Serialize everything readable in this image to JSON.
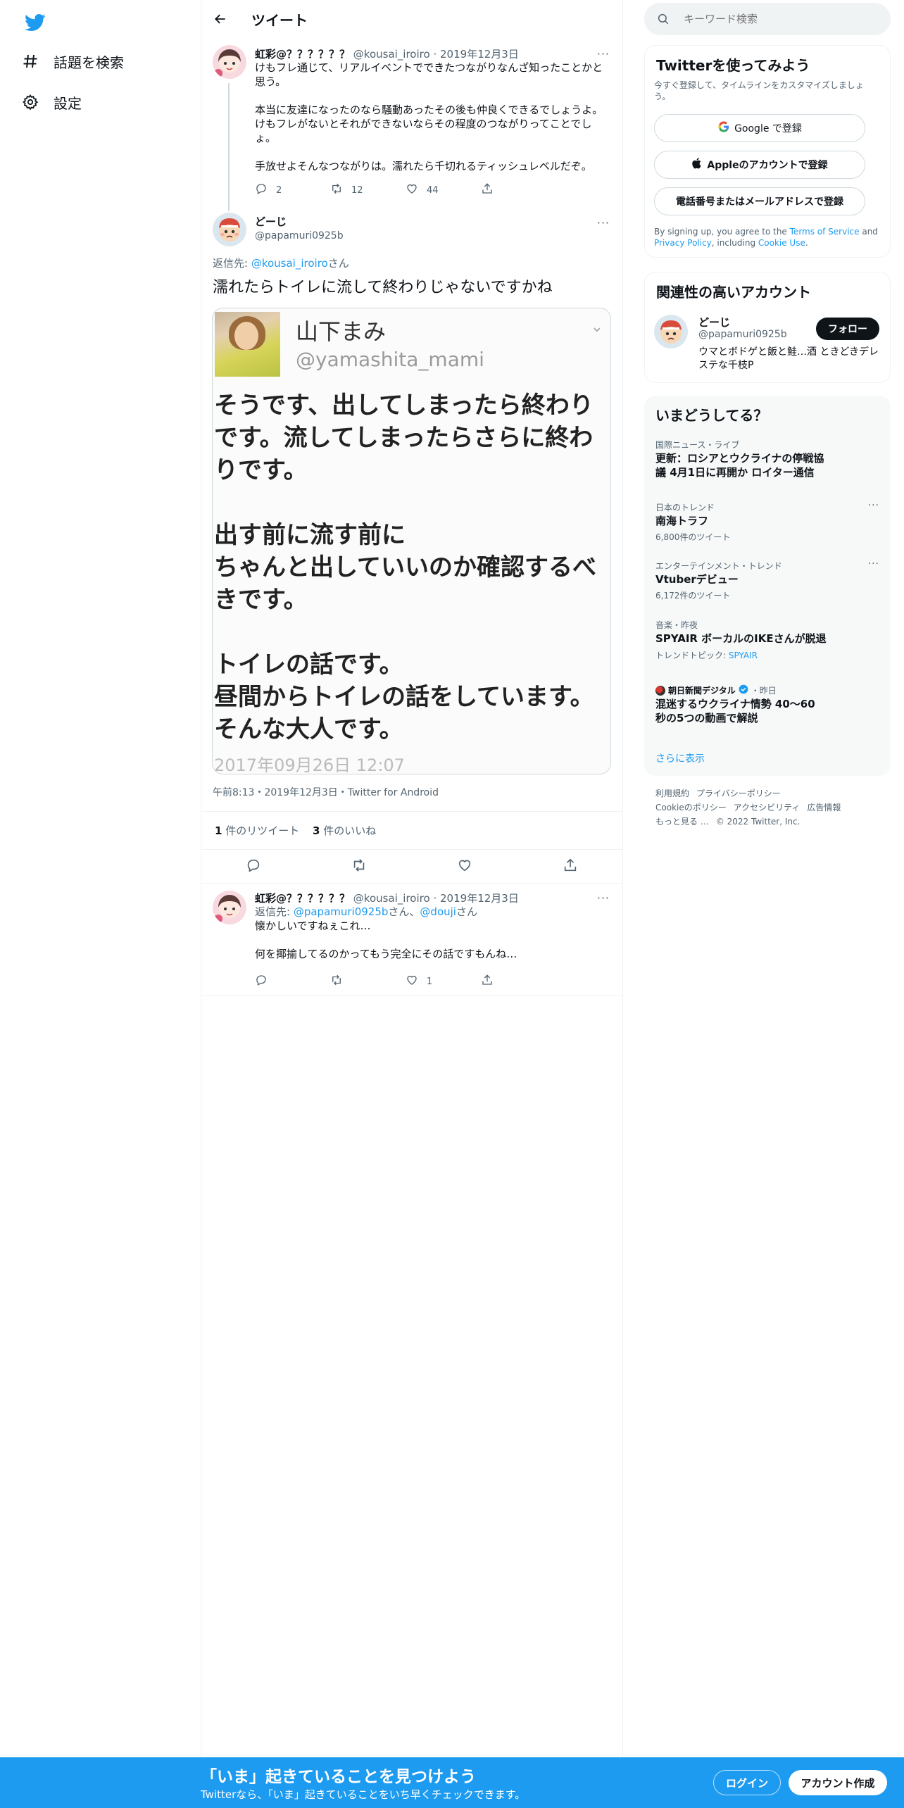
{
  "nav": {
    "logo": "twitter-bird-icon",
    "items": [
      {
        "label": "話題を検索",
        "icon": "hashtag-icon"
      },
      {
        "label": "設定",
        "icon": "gear-icon"
      }
    ]
  },
  "header": {
    "title": "ツイート"
  },
  "parent_tweet": {
    "name": "虹彩@？？？？？？",
    "handle": "@kousai_iroiro",
    "date": "2019年12月3日",
    "lines": [
      "けもフレ通じて、リアルイベントでできたつながりなんざ知ったことかと思う。",
      "",
      "本当に友達になったのなら騒動あったその後も仲良くできるでしょうよ。けもフレがないとそれができないならその程度のつながりってことでしょ。",
      "",
      "手放せよそんなつながりは。濡れたら千切れるティッシュレベルだぞ。"
    ],
    "replies": "2",
    "retweets": "12",
    "likes": "44"
  },
  "main_tweet": {
    "name": "どーじ",
    "handle": "@papamuri0925b",
    "reply_to_prefix": "返信先: ",
    "reply_to_handle": "@kousai_iroiro",
    "reply_to_suffix": "さん",
    "text": "濡れたらトイレに流して終わりじゃないですかね",
    "embedded_image": {
      "name": "山下まみ",
      "handle": "@yamashita_mami",
      "body": "そうです、出してしまったら終わりです。流してしまったらさらに終わりです。\n\n出す前に流す前に\nちゃんと出していいのか確認するべきです。\n\nトイレの話です。\n昼間からトイレの話をしています。\nそんな大人です。",
      "date": "2017年09月26日 12:07"
    },
    "meta": "午前8:13・2019年12月3日・Twitter for Android",
    "retweet_count": "1",
    "retweet_label": " 件のリツイート",
    "like_count": "3",
    "like_label": " 件のいいね"
  },
  "reply_tweet": {
    "name": "虹彩@？？？？？？",
    "handle": "@kousai_iroiro",
    "date": "2019年12月3日",
    "reply_to_prefix": "返信先: ",
    "reply_to_handle1": "@papamuri0925b",
    "reply_to_mid": "さん、",
    "reply_to_handle2": "@douji",
    "reply_to_suffix": "さん",
    "line1": "懐かしいですねぇこれ…",
    "line2": "何を揶揄してるのかってもう完全にその話ですもんね…",
    "likes": "1"
  },
  "search": {
    "placeholder": "キーワード検索"
  },
  "signup_card": {
    "title": "Twitterを使ってみよう",
    "subtitle": "今すぐ登録して、タイムラインをカスタマイズしましょう。",
    "google": "Google で登録",
    "apple": "Appleのアカウントで登録",
    "phone": "電話番号またはメールアドレスで登録",
    "legal_1": "By signing up, you agree to the ",
    "tos": "Terms of Service",
    "legal_2": " and ",
    "privacy": "Privacy Policy",
    "legal_3": ", including ",
    "cookie": "Cookie Use",
    "legal_4": "."
  },
  "related": {
    "title": "関連性の高いアカウント",
    "name": "どーじ",
    "handle": "@papamuri0925b",
    "bio": "ウマとボドゲと飯と鮭…酒 ときどきデレステな千枝P",
    "follow": "フォロー"
  },
  "trends": {
    "title": "いまどうしてる？",
    "items": [
      {
        "category": "国際ニュース・ライブ",
        "title": "更新：ロシアとウクライナの停戦協議 4月1日に再開か ロイター通信"
      },
      {
        "category": "日本のトレンド",
        "title": "南海トラフ",
        "count": "6,800件のツイート"
      },
      {
        "category": "エンターテインメント・トレンド",
        "title": "Vtuberデビュー",
        "count": "6,172件のツイート"
      },
      {
        "category": "音楽・昨夜",
        "title": "SPYAIR ボーカルのIKEさんが脱退",
        "topic_prefix": "トレンドトピック: ",
        "topic": "SPYAIR"
      },
      {
        "source": "朝日新聞デジタル",
        "time": "・昨日",
        "title": "混迷するウクライナ情勢 40～60秒の5つの動画で解説"
      }
    ],
    "more": "さらに表示"
  },
  "footer": {
    "links": [
      "利用規約",
      "プライバシーポリシー",
      "Cookieのポリシー",
      "アクセシビリティ",
      "広告情報",
      "もっと見る …"
    ],
    "copyright": "© 2022 Twitter, Inc."
  },
  "bottom_bar": {
    "title": "「いま」起きていることを見つけよう",
    "subtitle": "Twitterなら、「いま」起きていることをいち早くチェックできます。",
    "login": "ログイン",
    "signup": "アカウント作成"
  },
  "colors": {
    "accent": "#1d9bf0",
    "text": "#0f1419",
    "muted": "#536471",
    "border": "#eff3f4"
  }
}
